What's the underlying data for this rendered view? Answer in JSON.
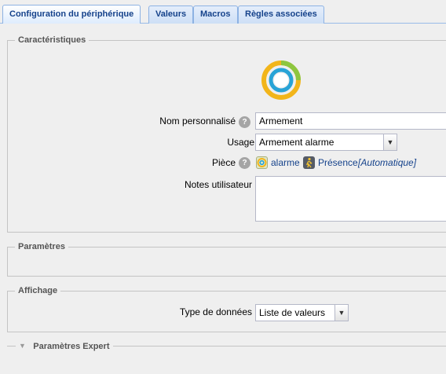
{
  "tabs": [
    {
      "label": "Configuration du périphérique",
      "active": true
    },
    {
      "label": "Valeurs",
      "active": false
    },
    {
      "label": "Macros",
      "active": false
    },
    {
      "label": "Règles associées",
      "active": false
    }
  ],
  "characteristics": {
    "legend": "Caractéristiques",
    "device_icon": "ring-status-icon",
    "name_label": "Nom personnalisé",
    "name_value": "Armement",
    "usage_label": "Usage",
    "usage_value": "Armement alarme",
    "room_label": "Pièce",
    "rooms": [
      {
        "icon": "alarm-room-icon",
        "label": "alarme"
      },
      {
        "icon": "presence-room-icon",
        "label": "Présence"
      }
    ],
    "room_auto": "[Automatique]",
    "notes_label": "Notes utilisateur",
    "notes_value": ""
  },
  "parameters": {
    "legend": "Paramètres"
  },
  "display": {
    "legend": "Affichage",
    "data_type_label": "Type de données",
    "data_type_value": "Liste de valeurs"
  },
  "expert": {
    "legend": "Paramètres Expert",
    "collapsed": true
  },
  "colors": {
    "tab_text": "#15428b",
    "link": "#15428b",
    "ring_yellow": "#f2b51a",
    "ring_green": "#8dc63f",
    "ring_blue": "#28a3d6"
  }
}
